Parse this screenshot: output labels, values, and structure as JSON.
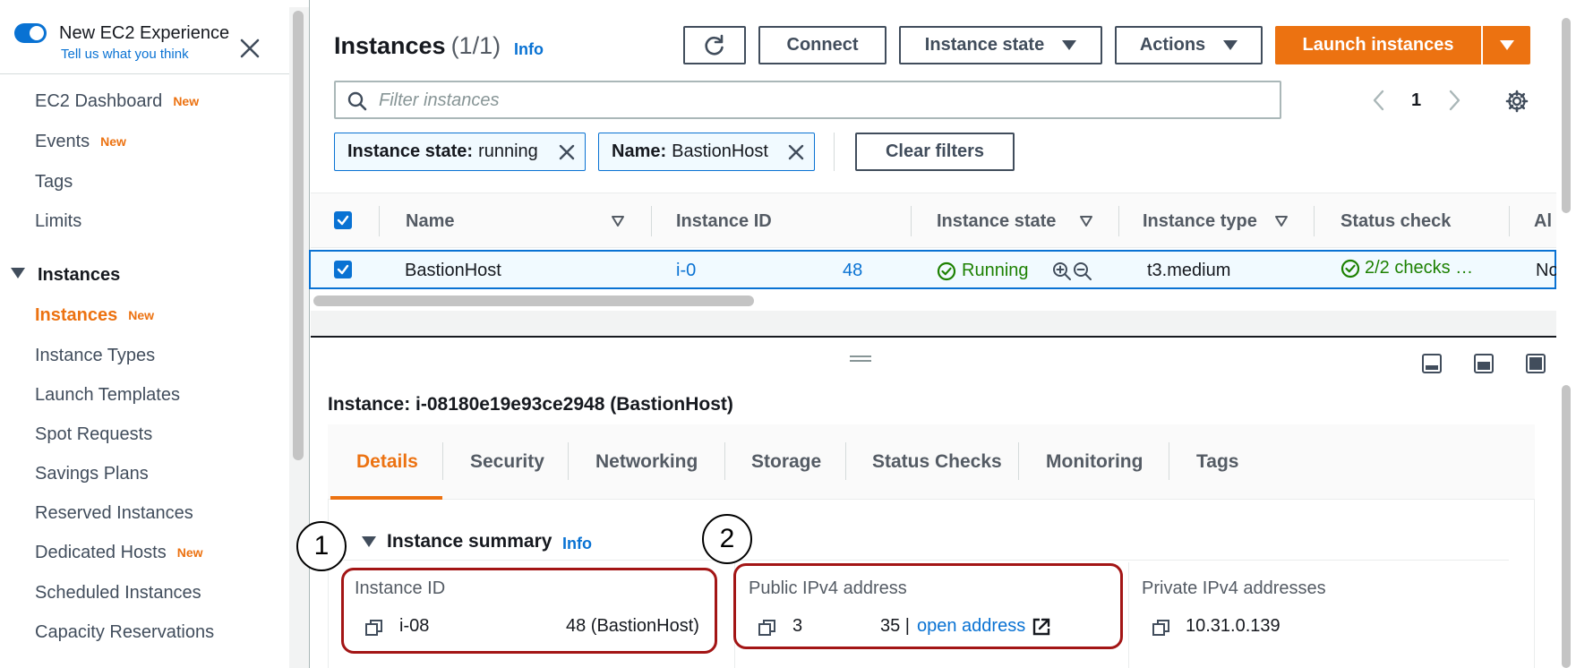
{
  "sidebar": {
    "experience_title": "New EC2 Experience",
    "experience_feedback": "Tell us what you think",
    "items_top": [
      {
        "label": "EC2 Dashboard",
        "badge": "New"
      },
      {
        "label": "Events",
        "badge": "New"
      },
      {
        "label": "Tags",
        "badge": ""
      },
      {
        "label": "Limits",
        "badge": ""
      }
    ],
    "section": "Instances",
    "items_instances": [
      {
        "label": "Instances",
        "badge": "New"
      },
      {
        "label": "Instance Types",
        "badge": ""
      },
      {
        "label": "Launch Templates",
        "badge": ""
      },
      {
        "label": "Spot Requests",
        "badge": ""
      },
      {
        "label": "Savings Plans",
        "badge": ""
      },
      {
        "label": "Reserved Instances",
        "badge": ""
      },
      {
        "label": "Dedicated Hosts",
        "badge": "New"
      },
      {
        "label": "Scheduled Instances",
        "badge": ""
      },
      {
        "label": "Capacity Reservations",
        "badge": ""
      }
    ]
  },
  "header": {
    "title": "Instances",
    "count": "(1/1)",
    "info": "Info",
    "connect": "Connect",
    "instance_state": "Instance state",
    "actions": "Actions",
    "launch": "Launch instances"
  },
  "filter": {
    "placeholder": "Filter instances",
    "page": "1",
    "tokens": [
      {
        "key": "Instance state:",
        "value": "running"
      },
      {
        "key": "Name:",
        "value": "BastionHost"
      }
    ],
    "clear": "Clear filters"
  },
  "table": {
    "columns": [
      "Name",
      "Instance ID",
      "Instance state",
      "Instance type",
      "Status check",
      "Al"
    ],
    "row": {
      "name": "BastionHost",
      "id_start": "i-0",
      "id_end": "48",
      "state": "Running",
      "type": "t3.medium",
      "status": "2/2 checks …",
      "alarm": "No"
    }
  },
  "detail": {
    "title": "Instance: i-08180e19e93ce2948 (BastionHost)",
    "tabs": [
      "Details",
      "Security",
      "Networking",
      "Storage",
      "Status Checks",
      "Monitoring",
      "Tags"
    ],
    "summary": "Instance summary",
    "summary_info": "Info",
    "fields": [
      {
        "label": "Instance ID",
        "value_start": "i-08",
        "value_end": "48 (BastionHost)"
      },
      {
        "label": "Public IPv4 address",
        "value_start": "3",
        "value_end": "35 |",
        "link": "open address"
      },
      {
        "label": "Private IPv4 addresses",
        "value_start": "10.31.0.139"
      }
    ]
  },
  "callouts": [
    "1",
    "2"
  ],
  "colors": {
    "accent": "#ec7211",
    "link": "#0972d3",
    "success": "#1d8102",
    "highlight": "#a31515"
  }
}
